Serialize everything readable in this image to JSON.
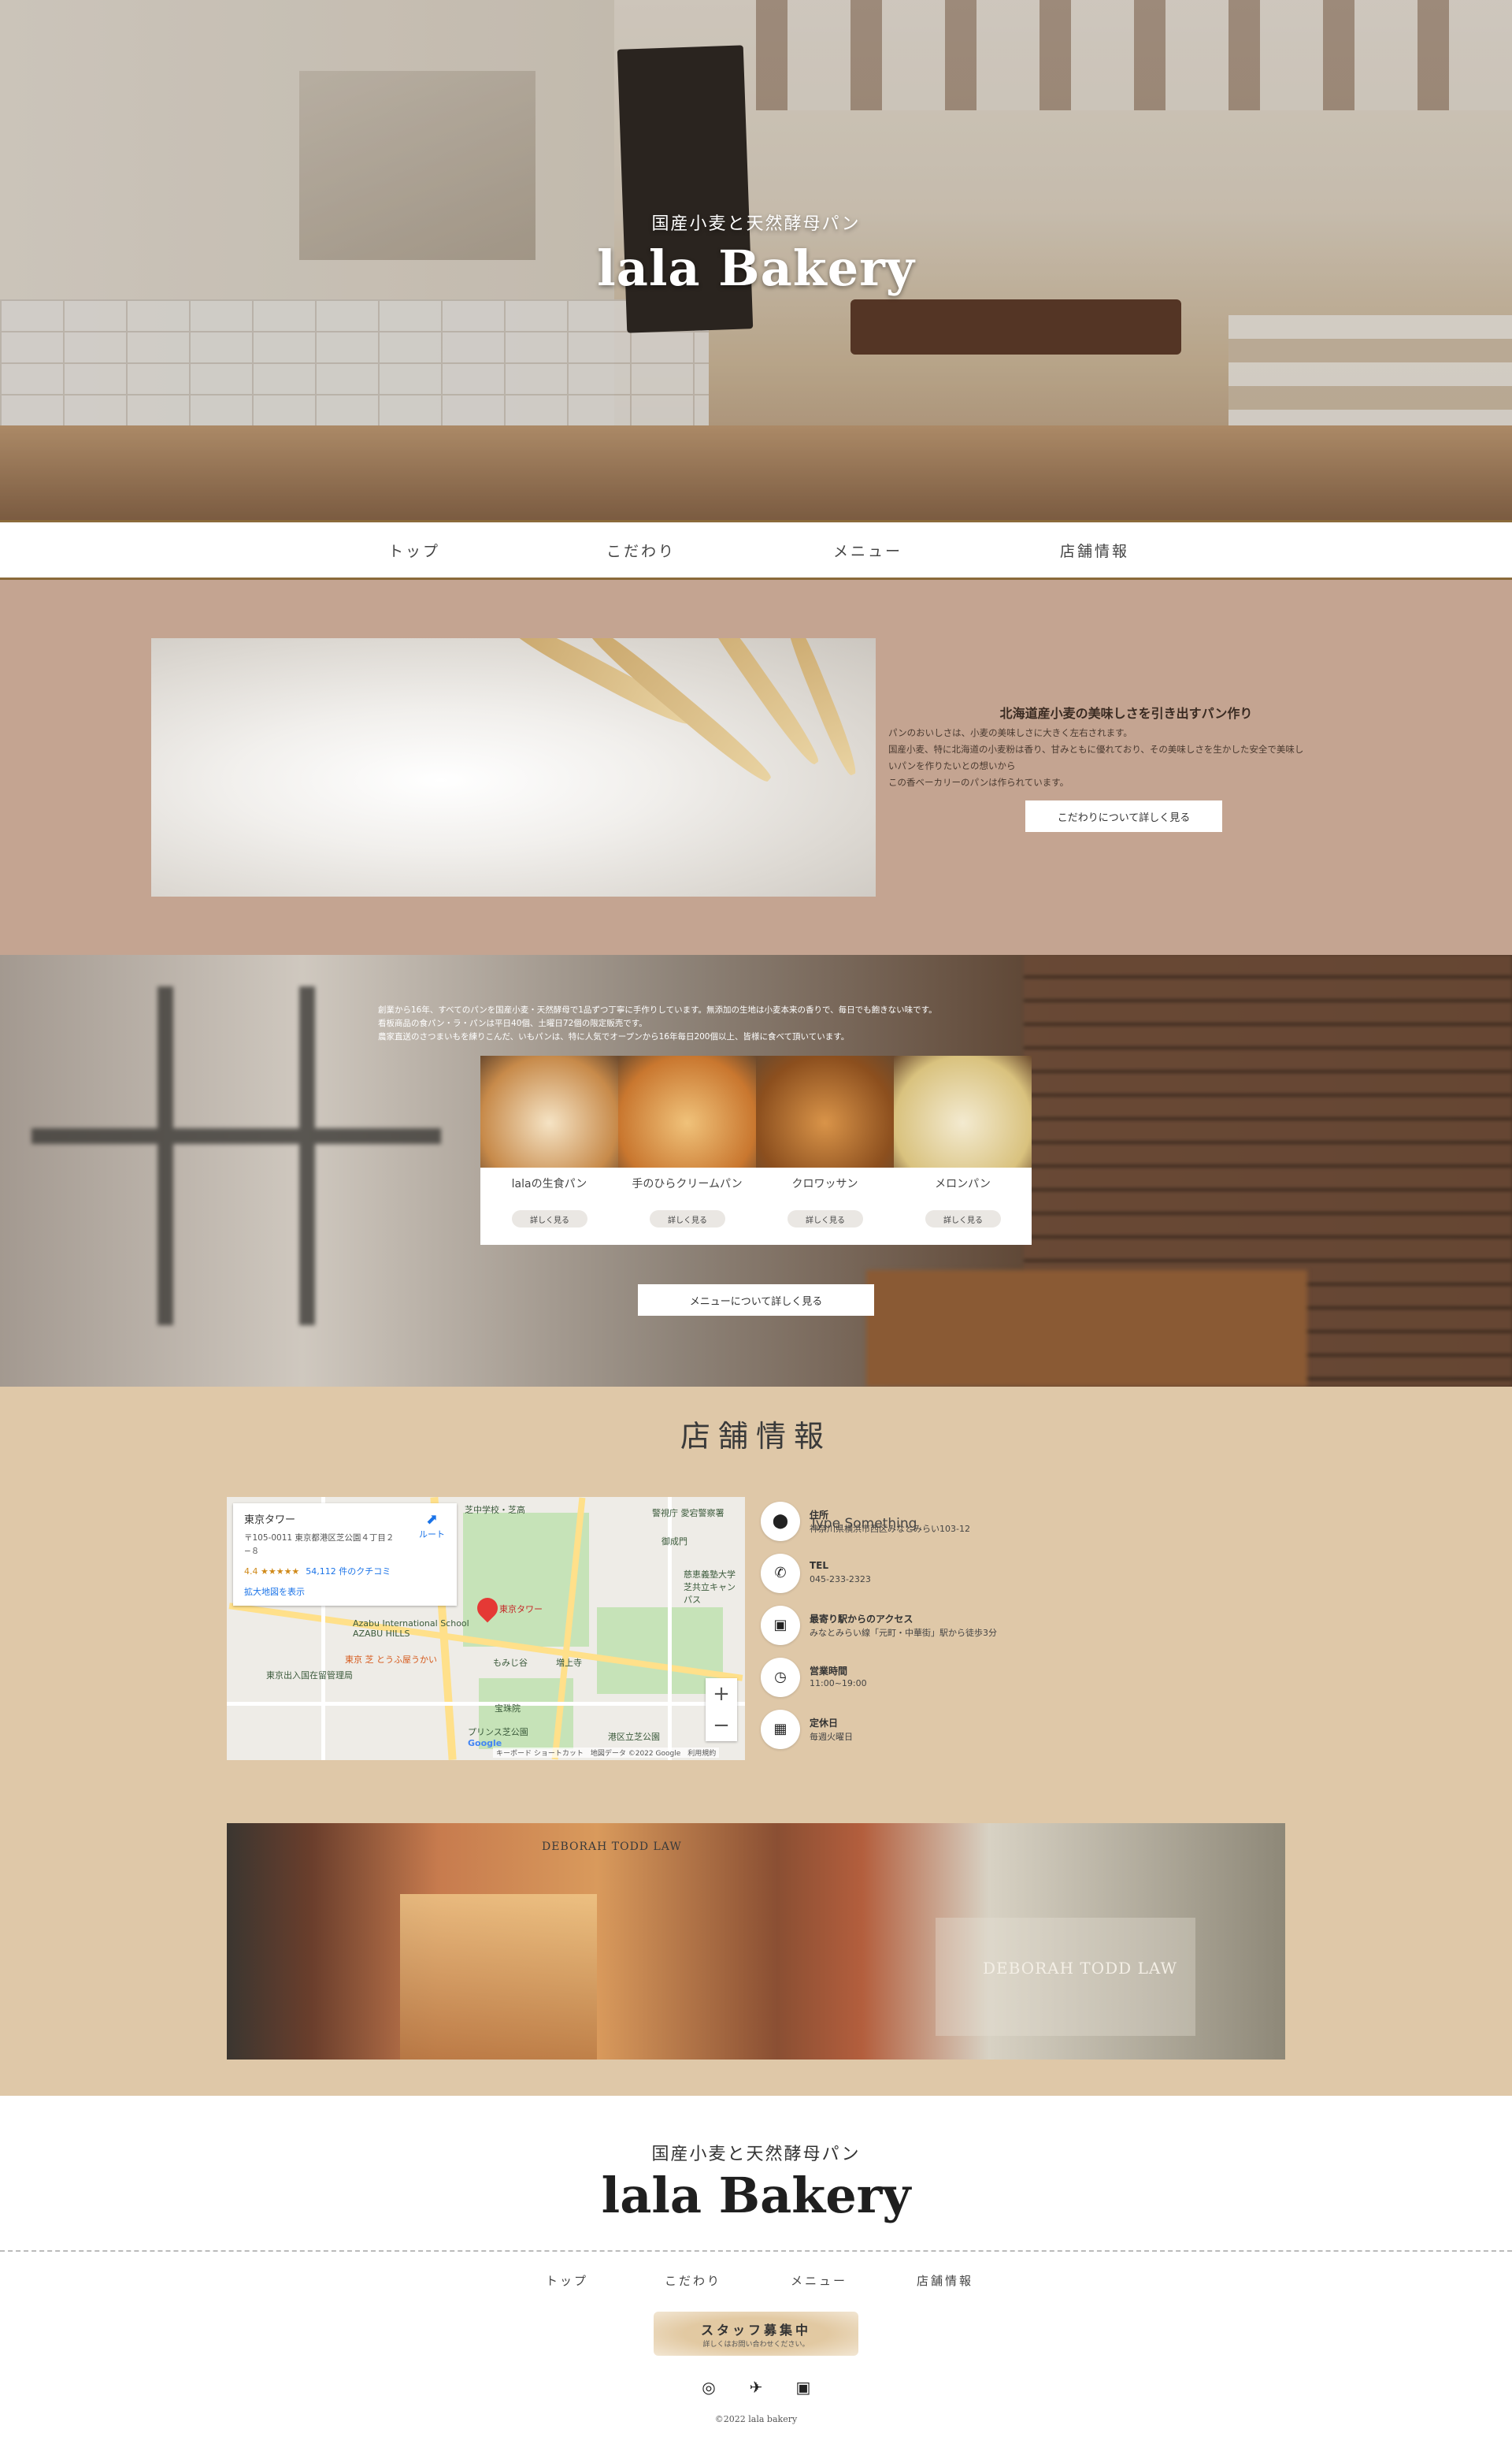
{
  "hero": {
    "subtitle": "国産小麦と天然酵母パン",
    "title": "lala Bakery"
  },
  "nav": {
    "items": [
      "トップ",
      "こだわり",
      "メニュー",
      "店舗情報"
    ]
  },
  "kodawari": {
    "title": "北海道産小麦の美味しさを引き出すパン作り",
    "body": [
      "パンのおいしさは、小麦の美味しさに大きく左右されます。",
      "国産小麦、特に北海道の小麦粉は香り、甘みともに優れており、その美味しさを生かした安全で美味し",
      "いパンを作りたいとの想いから",
      "この香ベーカリーのパンは作られています。"
    ],
    "button": "こだわりについて詳しく見る"
  },
  "menu": {
    "intro": [
      "創業から16年、すべてのパンを国産小麦・天然酵母で1品ずつ丁寧に手作りしています。無添加の生地は小麦本来の香りで、毎日でも飽きない味です。",
      "看板商品の食パン・ラ・パンは平日40個、土曜日72個の限定販売です。",
      "農家直送のさつまいもを練りこんだ、いもパンは、特に人気でオープンから16年毎日200個以上、皆様に食べて頂いています。"
    ],
    "cards": [
      {
        "name": "lalaの生食パン",
        "more": "詳しく見る",
        "color1": "#f5e3c4",
        "color2": "#c78a4a"
      },
      {
        "name": "手のひらクリームパン",
        "more": "詳しく見る",
        "color1": "#f0c27a",
        "color2": "#c9772f"
      },
      {
        "name": "クロワッサン",
        "more": "詳しく見る",
        "color1": "#d99449",
        "color2": "#8c4f1e"
      },
      {
        "name": "メロンパン",
        "more": "詳しく見る",
        "color1": "#f3ead0",
        "color2": "#d9c27e"
      }
    ],
    "button": "メニューについて詳しく見る"
  },
  "shop": {
    "title": "店舗情報",
    "map": {
      "place": "東京タワー",
      "address": "〒105-0011 東京都港区芝公園４丁目２−８",
      "rating": "4.4 ★★★★★",
      "reviews": "54,112 件のクチコミ",
      "enlarge": "拡大地図を表示",
      "route": "ルート",
      "labels": [
        "芝中学校・芝高",
        "警視庁 愛宕警察署",
        "御成門",
        "慈恵義塾大学芝共立キャンパス",
        "東京タワー",
        "Azabu International School AZABU HILLS",
        "東京 芝 とうふ屋うかい",
        "もみじ谷",
        "増上寺",
        "宝珠院",
        "プリンス芝公園",
        "港区立芝公園",
        "東京出入国在留管理局",
        "Google"
      ],
      "footer": "キーボード ショートカット　地図データ ©2022 Google　利用規約"
    },
    "extra_text": "Type Something",
    "info": [
      {
        "icon": "pin-icon",
        "label": "住所",
        "value": "神奈川県横浜市西区みなとみらい103-12"
      },
      {
        "icon": "phone-icon",
        "label": "TEL",
        "value": "045-233-2323"
      },
      {
        "icon": "train-icon",
        "label": "最寄り駅からのアクセス",
        "value": "みなとみらい線「元町・中華街」駅から徒歩3分"
      },
      {
        "icon": "clock-icon",
        "label": "営業時間",
        "value": "11:00~19:00"
      },
      {
        "icon": "calendar-icon",
        "label": "定休日",
        "value": "毎週火曜日"
      }
    ],
    "storefront_signs": [
      "DEBORAH TODD LAW",
      "DEBORAH TODD LAW"
    ]
  },
  "footer": {
    "subtitle": "国産小麦と天然酵母パン",
    "title": "lala Bakery",
    "nav": [
      "トップ",
      "こだわり",
      "メニュー",
      "店舗情報"
    ],
    "recruit_title": "スタッフ募集中",
    "recruit_sub": "詳しくはお問い合わせください。",
    "copyright": "©2022 lala bakery"
  },
  "colors": {
    "nav_border": "#8a6a3a",
    "kodawari_bg": "#c4a491",
    "shop_bg": "#dfc8a8"
  }
}
